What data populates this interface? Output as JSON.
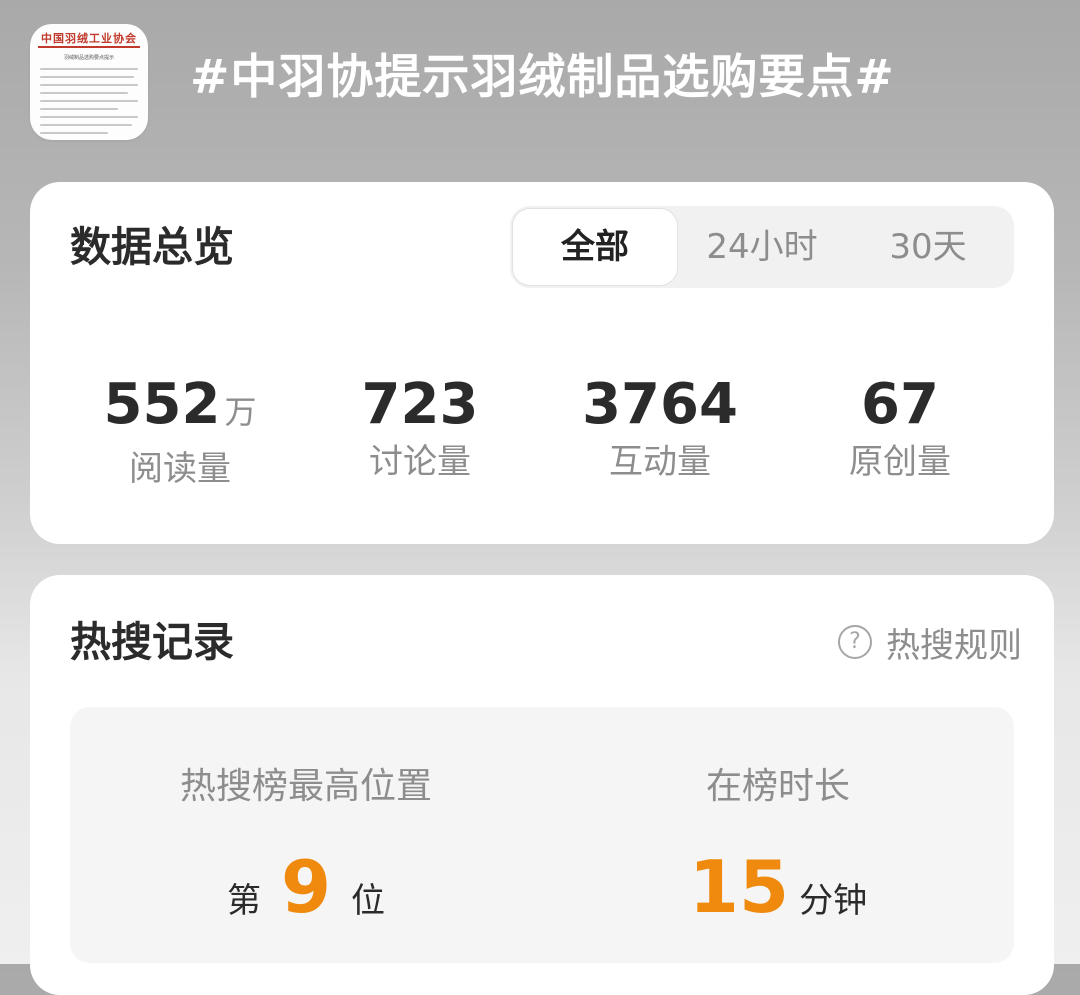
{
  "header": {
    "thumbnail_title": "中国羽绒工业协会",
    "thumbnail_subtitle": "羽绒制品选购要点提示",
    "topic_title": "#中羽协提示羽绒制品选购要点#"
  },
  "overview": {
    "title": "数据总览",
    "tabs": [
      {
        "label": "全部",
        "active": true
      },
      {
        "label": "24小时",
        "active": false
      },
      {
        "label": "30天",
        "active": false
      }
    ],
    "stats": [
      {
        "value": "552",
        "unit": "万",
        "label": "阅读量"
      },
      {
        "value": "723",
        "unit": "",
        "label": "讨论量"
      },
      {
        "value": "3764",
        "unit": "",
        "label": "互动量"
      },
      {
        "value": "67",
        "unit": "",
        "label": "原创量"
      }
    ]
  },
  "hot_search": {
    "title": "热搜记录",
    "rules_label": "热搜规则",
    "help_icon_glyph": "?",
    "highest_position": {
      "label": "热搜榜最高位置",
      "prefix": "第",
      "value": "9",
      "suffix": "位"
    },
    "duration": {
      "label": "在榜时长",
      "value": "15",
      "suffix": "分钟"
    }
  },
  "colors": {
    "accent": "#f08a0e",
    "text_primary": "#2b2b2b",
    "text_secondary": "#8d8d8d",
    "card_bg": "#ffffff",
    "thumbnail_red": "#c0392b"
  },
  "icons": {
    "help": "question-circle-icon"
  }
}
